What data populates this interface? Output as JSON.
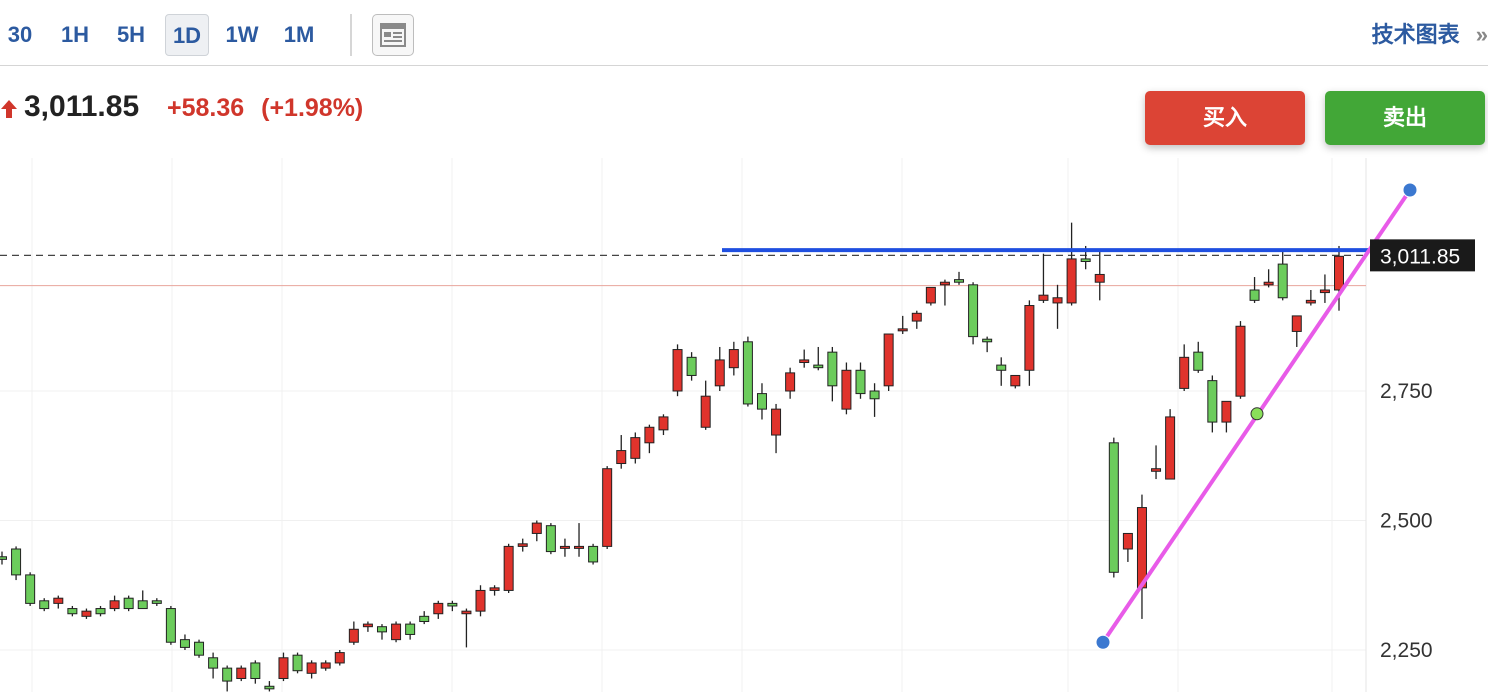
{
  "timeframes": [
    "30",
    "1H",
    "5H",
    "1D",
    "1W",
    "1M"
  ],
  "active_timeframe": "1D",
  "tech_chart_label": "技术图表",
  "tech_chart_chevron": "»",
  "quote": {
    "direction_icon": "arrow-up-icon",
    "price": "3,011.85",
    "change": "+58.36",
    "change_pct": "(+1.98%)",
    "up_color": "#d0362b"
  },
  "actions": {
    "buy_label": "买入",
    "sell_label": "卖出",
    "buy_color": "#dc4435",
    "sell_color": "#42a737"
  },
  "chart_data": {
    "type": "candlestick",
    "y_tick_labels": [
      "2,750",
      "2,500",
      "2,250"
    ],
    "y_ticks": [
      2750,
      2500,
      2250
    ],
    "last_price_label": "3,011.85",
    "last_price": 3011.85,
    "reference_price": 2953.49,
    "up_color": "#e0332c",
    "down_color": "#6ccc5c",
    "candles": [
      [
        2430,
        2440,
        2415,
        2425
      ],
      [
        2445,
        2450,
        2385,
        2395
      ],
      [
        2395,
        2400,
        2335,
        2340
      ],
      [
        2345,
        2350,
        2325,
        2330
      ],
      [
        2340,
        2355,
        2330,
        2350
      ],
      [
        2330,
        2335,
        2315,
        2320
      ],
      [
        2315,
        2330,
        2310,
        2325
      ],
      [
        2330,
        2335,
        2315,
        2320
      ],
      [
        2330,
        2355,
        2325,
        2345
      ],
      [
        2350,
        2355,
        2325,
        2330
      ],
      [
        2345,
        2365,
        2330,
        2330
      ],
      [
        2345,
        2350,
        2335,
        2340
      ],
      [
        2330,
        2335,
        2260,
        2265
      ],
      [
        2270,
        2280,
        2250,
        2255
      ],
      [
        2265,
        2270,
        2235,
        2240
      ],
      [
        2235,
        2245,
        2195,
        2215
      ],
      [
        2215,
        2220,
        2170,
        2190
      ],
      [
        2195,
        2220,
        2190,
        2215
      ],
      [
        2225,
        2230,
        2185,
        2195
      ],
      [
        2180,
        2190,
        2170,
        2175
      ],
      [
        2195,
        2245,
        2190,
        2235
      ],
      [
        2240,
        2245,
        2205,
        2210
      ],
      [
        2205,
        2230,
        2195,
        2225
      ],
      [
        2215,
        2230,
        2210,
        2225
      ],
      [
        2225,
        2250,
        2220,
        2245
      ],
      [
        2265,
        2305,
        2260,
        2290
      ],
      [
        2295,
        2305,
        2285,
        2300
      ],
      [
        2295,
        2300,
        2270,
        2285
      ],
      [
        2270,
        2305,
        2265,
        2300
      ],
      [
        2300,
        2305,
        2270,
        2280
      ],
      [
        2315,
        2325,
        2300,
        2305
      ],
      [
        2320,
        2345,
        2310,
        2340
      ],
      [
        2340,
        2345,
        2325,
        2335
      ],
      [
        2320,
        2330,
        2255,
        2325
      ],
      [
        2325,
        2375,
        2315,
        2365
      ],
      [
        2365,
        2375,
        2355,
        2370
      ],
      [
        2365,
        2455,
        2360,
        2450
      ],
      [
        2450,
        2465,
        2440,
        2455
      ],
      [
        2475,
        2500,
        2460,
        2495
      ],
      [
        2490,
        2495,
        2435,
        2440
      ],
      [
        2450,
        2465,
        2430,
        2450
      ],
      [
        2450,
        2495,
        2430,
        2450
      ],
      [
        2450,
        2455,
        2415,
        2420
      ],
      [
        2450,
        2605,
        2445,
        2600
      ],
      [
        2610,
        2665,
        2600,
        2635
      ],
      [
        2620,
        2670,
        2610,
        2660
      ],
      [
        2650,
        2685,
        2630,
        2680
      ],
      [
        2675,
        2705,
        2665,
        2700
      ],
      [
        2750,
        2840,
        2740,
        2830
      ],
      [
        2815,
        2825,
        2770,
        2780
      ],
      [
        2680,
        2770,
        2675,
        2740
      ],
      [
        2760,
        2835,
        2750,
        2810
      ],
      [
        2795,
        2845,
        2780,
        2830
      ],
      [
        2845,
        2855,
        2720,
        2725
      ],
      [
        2745,
        2765,
        2695,
        2715
      ],
      [
        2665,
        2725,
        2630,
        2715
      ],
      [
        2750,
        2795,
        2735,
        2785
      ],
      [
        2805,
        2830,
        2795,
        2810
      ],
      [
        2800,
        2835,
        2790,
        2795
      ],
      [
        2825,
        2835,
        2730,
        2760
      ],
      [
        2715,
        2805,
        2705,
        2790
      ],
      [
        2790,
        2805,
        2735,
        2745
      ],
      [
        2750,
        2765,
        2700,
        2735
      ],
      [
        2760,
        2860,
        2750,
        2860
      ],
      [
        2870,
        2895,
        2860,
        2870
      ],
      [
        2885,
        2905,
        2870,
        2900
      ],
      [
        2920,
        2940,
        2915,
        2950
      ],
      [
        2955,
        2965,
        2915,
        2960
      ],
      [
        2965,
        2980,
        2955,
        2960
      ],
      [
        2955,
        2960,
        2840,
        2855
      ],
      [
        2850,
        2855,
        2825,
        2845
      ],
      [
        2800,
        2815,
        2760,
        2790
      ],
      [
        2760,
        2775,
        2755,
        2780
      ],
      [
        2790,
        2925,
        2760,
        2915
      ],
      [
        2925,
        3015,
        2920,
        2935
      ],
      [
        2920,
        2955,
        2870,
        2930
      ],
      [
        2920,
        3075,
        2915,
        3005
      ],
      [
        3005,
        3030,
        2985,
        3000
      ],
      [
        2960,
        3025,
        2925,
        2975
      ],
      [
        2650,
        2660,
        2390,
        2400
      ],
      [
        2445,
        2470,
        2420,
        2475
      ],
      [
        2370,
        2550,
        2310,
        2525
      ],
      [
        2595,
        2645,
        2580,
        2600
      ],
      [
        2580,
        2715,
        2580,
        2700
      ],
      [
        2755,
        2840,
        2750,
        2815
      ],
      [
        2825,
        2845,
        2785,
        2790
      ],
      [
        2770,
        2780,
        2670,
        2690
      ],
      [
        2690,
        2725,
        2670,
        2730
      ],
      [
        2740,
        2885,
        2735,
        2875
      ],
      [
        2945,
        2970,
        2920,
        2925
      ],
      [
        2955,
        2985,
        2950,
        2960
      ],
      [
        2995,
        3025,
        2925,
        2930
      ],
      [
        2865,
        2885,
        2835,
        2895
      ],
      [
        2920,
        2945,
        2915,
        2925
      ],
      [
        2940,
        2975,
        2920,
        2945
      ],
      [
        2945,
        3030,
        2905,
        3010
      ]
    ],
    "horizontal_line_price": 3022,
    "trendline": {
      "start": [
        2265
      ],
      "mid": [
        2706
      ],
      "end": [
        3138
      ]
    }
  }
}
